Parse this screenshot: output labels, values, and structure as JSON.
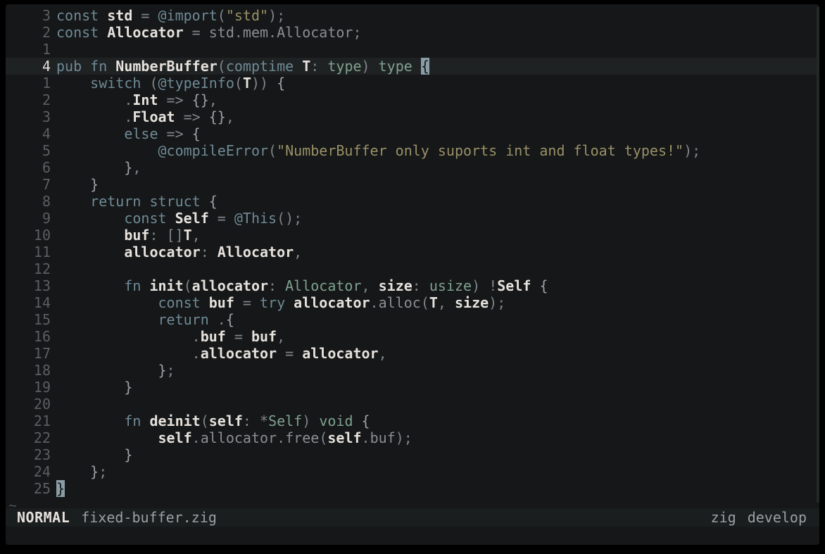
{
  "status": {
    "mode": "NORMAL",
    "filename": "fixed-buffer.zig",
    "filetype": "zig",
    "branch": "develop"
  },
  "cursor_line": 4,
  "lines": [
    {
      "rel": "3",
      "tokens": [
        [
          "kw",
          "const "
        ],
        [
          "ident",
          "std"
        ],
        [
          "punct",
          " = "
        ],
        [
          "builtin",
          "@import"
        ],
        [
          "punct",
          "("
        ],
        [
          "str",
          "\"std\""
        ],
        [
          "punct",
          ");"
        ]
      ]
    },
    {
      "rel": "2",
      "tokens": [
        [
          "kw",
          "const "
        ],
        [
          "ident",
          "Allocator"
        ],
        [
          "punct",
          " = "
        ],
        [
          "dim",
          "std"
        ],
        [
          "punct",
          "."
        ],
        [
          "dim",
          "mem"
        ],
        [
          "punct",
          "."
        ],
        [
          "dim",
          "Allocator"
        ],
        [
          "punct",
          ";"
        ]
      ]
    },
    {
      "rel": "1",
      "tokens": []
    },
    {
      "rel": "4",
      "active": true,
      "tokens": [
        [
          "kw",
          "pub fn "
        ],
        [
          "fnname",
          "NumberBuffer"
        ],
        [
          "punct",
          "("
        ],
        [
          "kw",
          "comptime "
        ],
        [
          "ident",
          "T"
        ],
        [
          "punct",
          ": "
        ],
        [
          "ty",
          "type"
        ],
        [
          "punct",
          ") "
        ],
        [
          "ty",
          "type"
        ],
        [
          "punct",
          " "
        ],
        [
          "cursor",
          "{"
        ]
      ]
    },
    {
      "rel": "1",
      "tokens": [
        [
          "punct",
          "    "
        ],
        [
          "kw",
          "switch"
        ],
        [
          "punct",
          " ("
        ],
        [
          "builtin",
          "@typeInfo"
        ],
        [
          "punct",
          "("
        ],
        [
          "ident",
          "T"
        ],
        [
          "punct",
          ")) "
        ],
        [
          "brace",
          "{"
        ]
      ]
    },
    {
      "rel": "2",
      "tokens": [
        [
          "punct",
          "        ."
        ],
        [
          "ident",
          "Int"
        ],
        [
          "punct",
          " => "
        ],
        [
          "brace",
          "{}"
        ],
        [
          "punct",
          ","
        ]
      ]
    },
    {
      "rel": "3",
      "tokens": [
        [
          "punct",
          "        ."
        ],
        [
          "ident",
          "Float"
        ],
        [
          "punct",
          " => "
        ],
        [
          "brace",
          "{}"
        ],
        [
          "punct",
          ","
        ]
      ]
    },
    {
      "rel": "4",
      "tokens": [
        [
          "punct",
          "        "
        ],
        [
          "kw",
          "else"
        ],
        [
          "punct",
          " => "
        ],
        [
          "brace",
          "{"
        ]
      ]
    },
    {
      "rel": "5",
      "tokens": [
        [
          "punct",
          "            "
        ],
        [
          "builtin",
          "@compileError"
        ],
        [
          "punct",
          "("
        ],
        [
          "str",
          "\"NumberBuffer only suports int and float types!\""
        ],
        [
          "punct",
          ");"
        ]
      ]
    },
    {
      "rel": "6",
      "tokens": [
        [
          "punct",
          "        "
        ],
        [
          "brace",
          "}"
        ],
        [
          "punct",
          ","
        ]
      ]
    },
    {
      "rel": "7",
      "tokens": [
        [
          "punct",
          "    "
        ],
        [
          "brace",
          "}"
        ]
      ]
    },
    {
      "rel": "8",
      "tokens": [
        [
          "punct",
          "    "
        ],
        [
          "kw",
          "return"
        ],
        [
          "punct",
          " "
        ],
        [
          "kw",
          "struct"
        ],
        [
          "punct",
          " "
        ],
        [
          "brace",
          "{"
        ]
      ]
    },
    {
      "rel": "9",
      "tokens": [
        [
          "punct",
          "        "
        ],
        [
          "kw",
          "const "
        ],
        [
          "ident",
          "Self"
        ],
        [
          "punct",
          " = "
        ],
        [
          "builtin",
          "@This"
        ],
        [
          "punct",
          "();"
        ]
      ]
    },
    {
      "rel": "10",
      "tokens": [
        [
          "punct",
          "        "
        ],
        [
          "ident",
          "buf"
        ],
        [
          "punct",
          ": []"
        ],
        [
          "ident",
          "T"
        ],
        [
          "punct",
          ","
        ]
      ]
    },
    {
      "rel": "11",
      "tokens": [
        [
          "punct",
          "        "
        ],
        [
          "ident",
          "allocator"
        ],
        [
          "punct",
          ": "
        ],
        [
          "ident",
          "Allocator"
        ],
        [
          "punct",
          ","
        ]
      ]
    },
    {
      "rel": "12",
      "tokens": []
    },
    {
      "rel": "13",
      "tokens": [
        [
          "punct",
          "        "
        ],
        [
          "kw",
          "fn "
        ],
        [
          "fnname",
          "init"
        ],
        [
          "punct",
          "("
        ],
        [
          "ident",
          "allocator"
        ],
        [
          "punct",
          ": "
        ],
        [
          "ty",
          "Allocator"
        ],
        [
          "punct",
          ", "
        ],
        [
          "ident",
          "size"
        ],
        [
          "punct",
          ": "
        ],
        [
          "ty",
          "usize"
        ],
        [
          "punct",
          ") "
        ],
        [
          "op",
          "!"
        ],
        [
          "ident",
          "Self"
        ],
        [
          "punct",
          " "
        ],
        [
          "brace",
          "{"
        ]
      ]
    },
    {
      "rel": "14",
      "tokens": [
        [
          "punct",
          "            "
        ],
        [
          "kw",
          "const "
        ],
        [
          "ident",
          "buf"
        ],
        [
          "punct",
          " = "
        ],
        [
          "kw",
          "try "
        ],
        [
          "ident",
          "allocator"
        ],
        [
          "punct",
          "."
        ],
        [
          "dim",
          "alloc"
        ],
        [
          "punct",
          "("
        ],
        [
          "ident",
          "T"
        ],
        [
          "punct",
          ", "
        ],
        [
          "ident",
          "size"
        ],
        [
          "punct",
          ");"
        ]
      ]
    },
    {
      "rel": "15",
      "tokens": [
        [
          "punct",
          "            "
        ],
        [
          "kw",
          "return"
        ],
        [
          "punct",
          " ."
        ],
        [
          "brace",
          "{"
        ]
      ]
    },
    {
      "rel": "16",
      "tokens": [
        [
          "punct",
          "                ."
        ],
        [
          "ident",
          "buf"
        ],
        [
          "punct",
          " = "
        ],
        [
          "ident",
          "buf"
        ],
        [
          "punct",
          ","
        ]
      ]
    },
    {
      "rel": "17",
      "tokens": [
        [
          "punct",
          "                ."
        ],
        [
          "ident",
          "allocator"
        ],
        [
          "punct",
          " = "
        ],
        [
          "ident",
          "allocator"
        ],
        [
          "punct",
          ","
        ]
      ]
    },
    {
      "rel": "18",
      "tokens": [
        [
          "punct",
          "            "
        ],
        [
          "brace",
          "}"
        ],
        [
          "punct",
          ";"
        ]
      ]
    },
    {
      "rel": "19",
      "tokens": [
        [
          "punct",
          "        "
        ],
        [
          "brace",
          "}"
        ]
      ]
    },
    {
      "rel": "20",
      "tokens": []
    },
    {
      "rel": "21",
      "tokens": [
        [
          "punct",
          "        "
        ],
        [
          "kw",
          "fn "
        ],
        [
          "fnname",
          "deinit"
        ],
        [
          "punct",
          "("
        ],
        [
          "ident",
          "self"
        ],
        [
          "punct",
          ": "
        ],
        [
          "op",
          "*"
        ],
        [
          "ty",
          "Self"
        ],
        [
          "punct",
          ") "
        ],
        [
          "ty",
          "void"
        ],
        [
          "punct",
          " "
        ],
        [
          "brace",
          "{"
        ]
      ]
    },
    {
      "rel": "22",
      "tokens": [
        [
          "punct",
          "            "
        ],
        [
          "ident",
          "self"
        ],
        [
          "punct",
          "."
        ],
        [
          "dim",
          "allocator"
        ],
        [
          "punct",
          "."
        ],
        [
          "dim",
          "free"
        ],
        [
          "punct",
          "("
        ],
        [
          "ident",
          "self"
        ],
        [
          "punct",
          "."
        ],
        [
          "dim",
          "buf"
        ],
        [
          "punct",
          ");"
        ]
      ]
    },
    {
      "rel": "23",
      "tokens": [
        [
          "punct",
          "        "
        ],
        [
          "brace",
          "}"
        ]
      ]
    },
    {
      "rel": "24",
      "tokens": [
        [
          "punct",
          "    "
        ],
        [
          "brace",
          "}"
        ],
        [
          "punct",
          ";"
        ]
      ]
    },
    {
      "rel": "25",
      "tokens": [
        [
          "cursor",
          "}"
        ]
      ]
    }
  ],
  "tilde": "~"
}
